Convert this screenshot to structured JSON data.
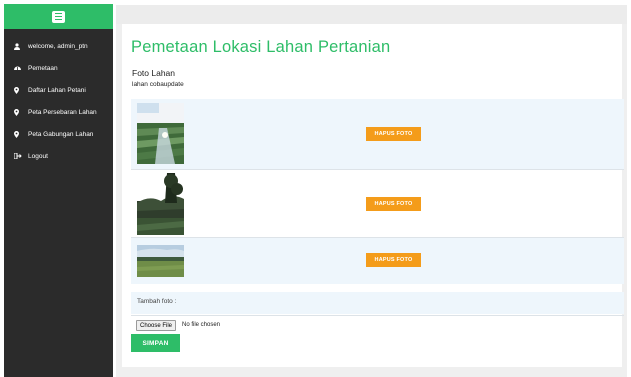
{
  "sidebar": {
    "toggle_icon": "hamburger-icon",
    "items": [
      {
        "label": "welcome, admin_ptn",
        "icon": "user-icon"
      },
      {
        "label": "Pemetaan",
        "icon": "dashboard-icon"
      },
      {
        "label": "Daftar Lahan Petani",
        "icon": "map-marker-icon"
      },
      {
        "label": "Peta Persebaran Lahan",
        "icon": "map-marker-icon"
      },
      {
        "label": "Peta Gabungan Lahan",
        "icon": "map-marker-icon"
      },
      {
        "label": "Logout",
        "icon": "sign-out-icon"
      }
    ]
  },
  "main": {
    "title": "Pemetaan Lokasi Lahan Pertanian",
    "section_title": "Foto Lahan",
    "section_subtitle": "lahan cobaupdate",
    "photos": [
      {
        "delete_label": "HAPUS FOTO"
      },
      {
        "delete_label": "HAPUS FOTO"
      },
      {
        "delete_label": "HAPUS FOTO"
      }
    ],
    "add_photo_label": "Tambah foto :",
    "file_input": {
      "button_label": "Choose File",
      "status": "No file chosen"
    },
    "save_label": "SIMPAN"
  },
  "colors": {
    "accent": "#2ebd68",
    "sidebar_bg": "#2b2b2b",
    "delete_button": "#f49c1a",
    "row_highlight": "#eef6fc"
  }
}
